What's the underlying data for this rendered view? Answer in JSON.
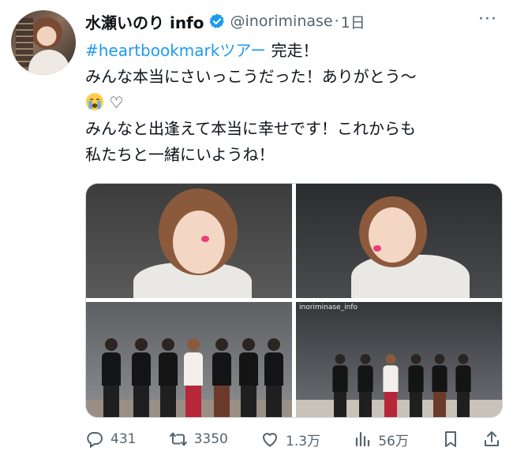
{
  "tweet": {
    "display_name": "水瀬いのり info",
    "handle": "@inoriminase",
    "separator": "·",
    "time": "1日",
    "more_label": "···",
    "text": {
      "hashtag": "#heartbookmarkツアー",
      "line1_rest": " 完走！",
      "line2": "みんな本当にさいっこうだった！ありがとう〜",
      "line3_heart": "♡",
      "line4": "みんなと出逢えて本当に幸せです！これからも",
      "line5": "私たちと一緒にいようね！"
    },
    "media": {
      "watermark": "inoriminase_info"
    },
    "stats": {
      "replies": "431",
      "retweets": "3350",
      "likes": "1.3万",
      "views": "56万"
    }
  },
  "colors": {
    "link": "#1d9bf0",
    "verified": "#1d9bf0",
    "muted": "#536471",
    "text": "#0f1419"
  },
  "icons": {
    "verified": "verified-badge-icon",
    "reply": "reply-icon",
    "retweet": "retweet-icon",
    "like": "heart-icon",
    "views": "views-chart-icon",
    "bookmark": "bookmark-icon",
    "share": "share-icon",
    "emoji": "loudly-crying-face-emoji"
  }
}
